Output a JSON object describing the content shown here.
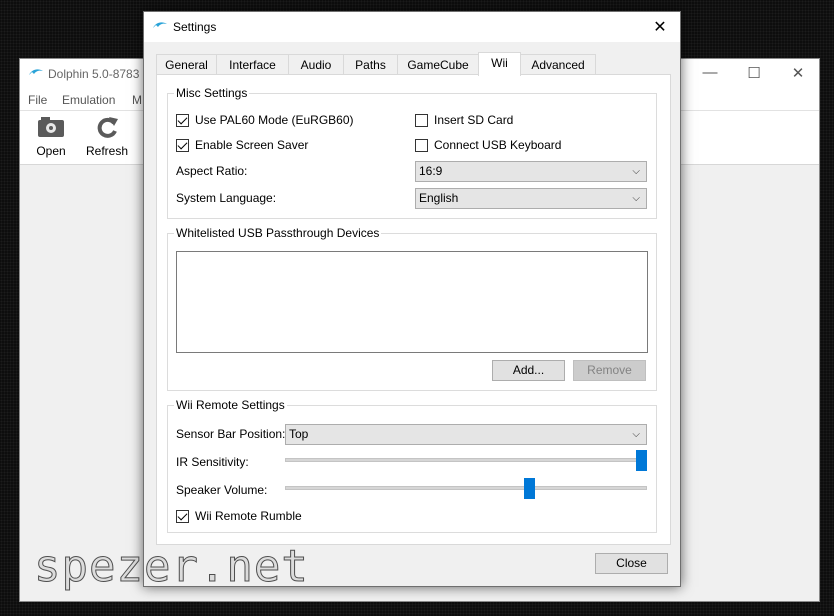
{
  "main_window": {
    "title": "Dolphin 5.0-8783",
    "menu": [
      "File",
      "Emulation",
      "M"
    ],
    "toolbar": {
      "open_label": "Open",
      "refresh_label": "Refresh"
    },
    "controls": {
      "minimize": "—",
      "maximize": "☐",
      "close": "✕"
    }
  },
  "dialog": {
    "title": "Settings",
    "close_glyph": "✕",
    "tabs": [
      "General",
      "Interface",
      "Audio",
      "Paths",
      "GameCube",
      "Wii",
      "Advanced"
    ],
    "active_tab": "Wii",
    "misc": {
      "title": "Misc Settings",
      "use_pal60": {
        "label": "Use PAL60 Mode (EuRGB60)",
        "checked": true
      },
      "insert_sd": {
        "label": "Insert SD Card",
        "checked": false
      },
      "screen_saver": {
        "label": "Enable Screen Saver",
        "checked": true
      },
      "usb_keyboard": {
        "label": "Connect USB Keyboard",
        "checked": false
      },
      "aspect_label": "Aspect Ratio:",
      "aspect_value": "16:9",
      "language_label": "System Language:",
      "language_value": "English"
    },
    "usb": {
      "title": "Whitelisted USB Passthrough Devices",
      "add_label": "Add...",
      "remove_label": "Remove"
    },
    "wii_remote": {
      "title": "Wii Remote Settings",
      "sensor_label": "Sensor Bar Position:",
      "sensor_value": "Top",
      "ir_label": "IR Sensitivity:",
      "ir_value": 1.0,
      "speaker_label": "Speaker Volume:",
      "speaker_value": 0.68,
      "rumble": {
        "label": "Wii Remote Rumble",
        "checked": true
      }
    },
    "close_button": "Close"
  },
  "watermark": "spezer.net",
  "colors": {
    "accent": "#0078d7",
    "dolphin_icon": "#2aa3d8"
  }
}
